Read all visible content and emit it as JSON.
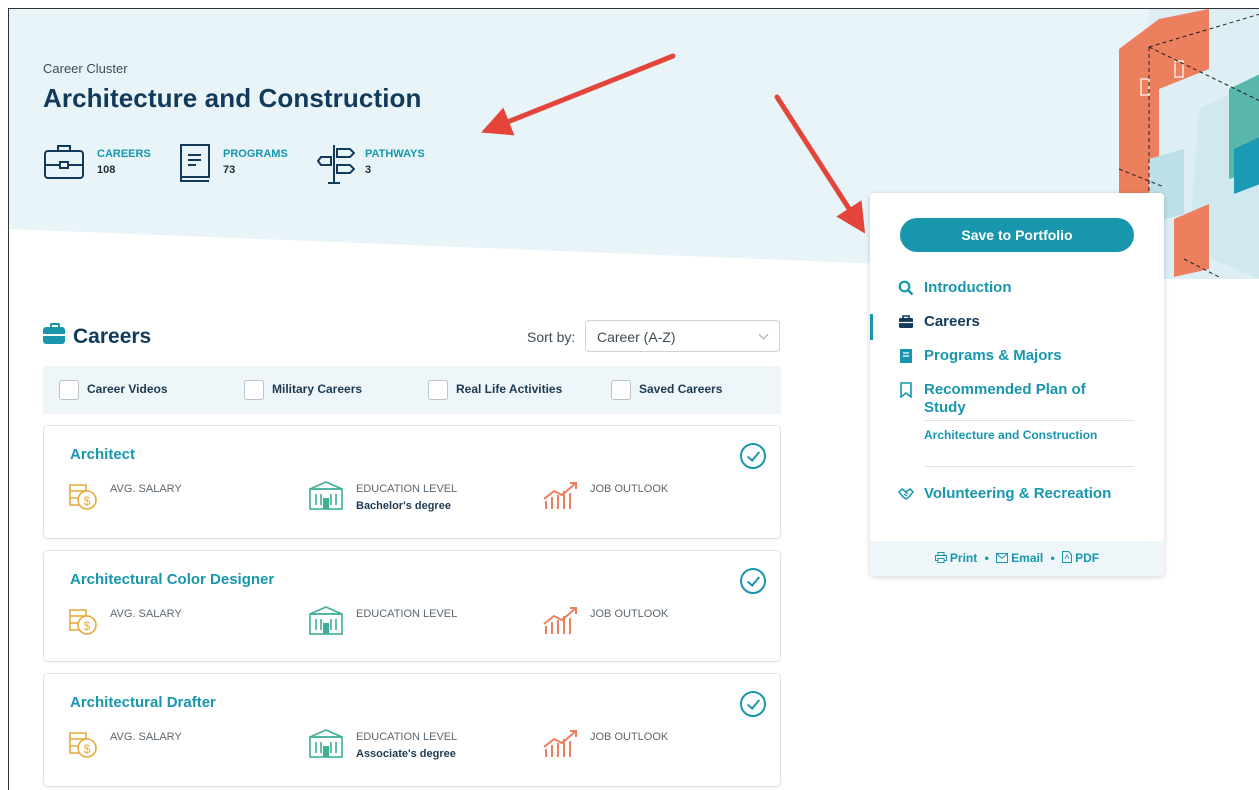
{
  "cluster": {
    "label": "Career Cluster",
    "title": "Architecture and Construction",
    "stats": [
      {
        "label": "CAREERS",
        "value": "108",
        "icon": "briefcase-icon"
      },
      {
        "label": "PROGRAMS",
        "value": "73",
        "icon": "book-icon"
      },
      {
        "label": "PATHWAYS",
        "value": "3",
        "icon": "signpost-icon"
      }
    ]
  },
  "careers": {
    "heading": "Careers",
    "sort_label": "Sort by:",
    "sort_value": "Career (A-Z)",
    "filters": [
      "Career Videos",
      "Military Careers",
      "Real Life Activities",
      "Saved Careers"
    ],
    "metric_labels": {
      "salary": "AVG. SALARY",
      "education": "EDUCATION LEVEL",
      "outlook": "JOB OUTLOOK"
    },
    "items": [
      {
        "title": "Architect",
        "education": "Bachelor's degree"
      },
      {
        "title": "Architectural Color Designer",
        "education": ""
      },
      {
        "title": "Architectural Drafter",
        "education": "Associate's degree"
      }
    ]
  },
  "sidebar": {
    "save_button": "Save to Portfolio",
    "nav": [
      {
        "label": "Introduction",
        "icon": "search-icon",
        "active": false
      },
      {
        "label": "Careers",
        "icon": "briefcase-icon",
        "active": true
      },
      {
        "label": "Programs & Majors",
        "icon": "book-icon",
        "active": false
      },
      {
        "label": "Recommended Plan of Study",
        "icon": "bookmark-icon",
        "active": false
      },
      {
        "label": "Volunteering & Recreation",
        "icon": "handshake-icon",
        "active": false
      }
    ],
    "sub_link": "Architecture and Construction",
    "footer": {
      "print": "Print",
      "email": "Email",
      "pdf": "PDF",
      "separator": "•"
    }
  },
  "colors": {
    "accent": "#1796ae",
    "title": "#123a5a",
    "hero_bg": "#e6f3f7",
    "salary_icon": "#e6a93c",
    "education_icon": "#3fae97",
    "outlook_icon": "#ec7f5e"
  }
}
